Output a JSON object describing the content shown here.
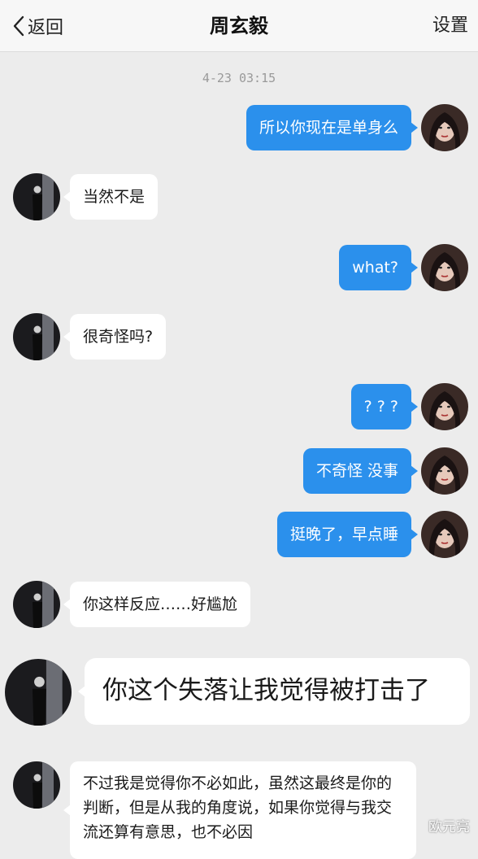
{
  "header": {
    "back_label": "返回",
    "title": "周玄毅",
    "settings_label": "设置"
  },
  "timestamp": "4-23 03:15",
  "messages": [
    {
      "side": "out",
      "text": "所以你现在是单身么"
    },
    {
      "side": "in",
      "text": "当然不是"
    },
    {
      "side": "out",
      "text": "what?"
    },
    {
      "side": "in",
      "text": "很奇怪吗?"
    },
    {
      "side": "out",
      "text": "? ? ?"
    },
    {
      "side": "out",
      "text": "不奇怪 没事"
    },
    {
      "side": "out",
      "text": "挺晚了，早点睡"
    },
    {
      "side": "in",
      "text": "你这样反应……好尴尬"
    },
    {
      "side": "in",
      "text": "你这个失落让我觉得被打击了"
    },
    {
      "side": "in",
      "text": "不过我是觉得你不必如此，虽然这最终是你的判断，但是从我的角度说，如果你觉得与我交流还算有意思，也不必因"
    }
  ],
  "watermark": "欧元亮",
  "colors": {
    "outgoing_bubble": "#2b90ec",
    "incoming_bubble": "#ffffff",
    "background": "#ececec"
  }
}
